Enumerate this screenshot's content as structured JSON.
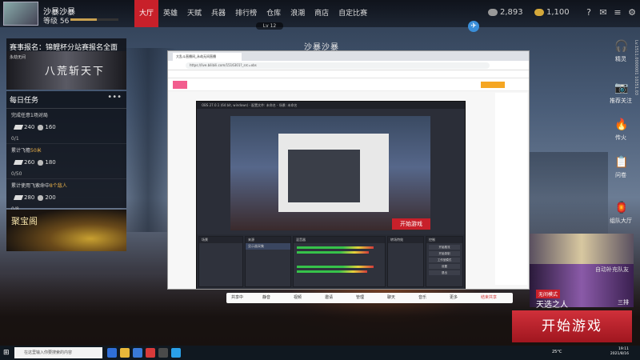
{
  "player": {
    "name": "沙暴沙暴",
    "level_label": "等级 56",
    "level_progress": 0.55,
    "badge": "Lv 12"
  },
  "nav": [
    "大厅",
    "英雄",
    "天赋",
    "兵器",
    "排行榜",
    "仓库",
    "浪潮",
    "商店",
    "自定比赛"
  ],
  "nav_active": "大厅",
  "currency": {
    "silver": "2,893",
    "gold": "1,100"
  },
  "map_name": "沙暴沙暴",
  "event": {
    "title": "赛事报名：锦鲤杯分站赛报名全面开启",
    "logo": "永劫无间",
    "art_text": "八荒斩天下"
  },
  "daily_tasks": {
    "title": "每日任务",
    "more": "•••",
    "items": [
      {
        "desc": "完成任意1场对局",
        "highlight": "",
        "reward_a": "240",
        "reward_b": "160",
        "progress": "0/1"
      },
      {
        "desc": "累计飞檐",
        "highlight": "50米",
        "reward_a": "260",
        "reward_b": "180",
        "progress": "0/50"
      },
      {
        "desc": "累计使用飞索命中",
        "highlight": "8个敌人",
        "reward_a": "280",
        "reward_b": "200",
        "progress": "0/8"
      }
    ]
  },
  "treasure_label": "聚宝阁",
  "side_buttons": [
    "精灵",
    "推荐关注",
    "传火",
    "问卷",
    "组队大厅"
  ],
  "vertical_id": "Lv.1511.0000001 10251.03",
  "squad": {
    "match_label": "自动补充队友",
    "mode_tag": "无间模式",
    "mode_name": "天选之人",
    "extra": "三排"
  },
  "start_button": "开始游戏",
  "browser": {
    "tab_title": "大乱斗直播间_永劫无间直播",
    "url": "https://live.bilibili.com/1516301?_src=obs"
  },
  "obs": {
    "title": "OBS 27.0.1 (64 bit, windows) - 配置文件: 未命名 - 场景: 未命名",
    "mini_start": "开始游戏",
    "docks": [
      "来源",
      "混音器",
      "转场特效",
      "控制"
    ],
    "source_name": "显示器采集",
    "scene_name": "场景",
    "controls": [
      "开始推流",
      "开始录制",
      "工作室模式",
      "设置",
      "退出"
    ]
  },
  "share_bar": [
    "共享中",
    "静音",
    "视频",
    "邀请",
    "管理",
    "聊天",
    "音乐",
    "更多",
    "结束共享"
  ],
  "taskbar": {
    "search_placeholder": "在这里输入你要搜索的内容",
    "weather": "25°C",
    "time": "19:11",
    "date": "2021/8/16"
  }
}
